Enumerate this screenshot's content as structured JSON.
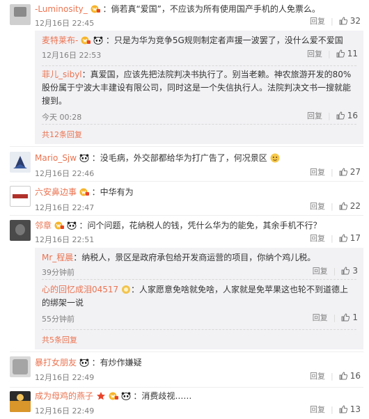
{
  "actions": {
    "reply": "回复"
  },
  "comments": [
    {
      "user": "-Luminosity_",
      "text": "：倘若真“爱国”，不应该为所有使用国产手机的人免票么。",
      "time": "12月16日 22:45",
      "likes": "32",
      "sub": {
        "replies": [
          {
            "user": "麦特莱布-",
            "text": "：只是为华为竞争5G规则制定者声援一波罢了，没什么爱不爱国",
            "time": "12月16日 22:53",
            "likes": "11"
          },
          {
            "user": "菲儿_sibyl",
            "text_lines": [
              "：真爱国，应该先把法院判决书执行了。别当老赖。神农旅游开发的80%",
              "股份属于宁波大丰建设有限公司，同时这是一个失信执行人。法院判决文书一搜就能",
              "搜到。"
            ],
            "time": "今天 00:28",
            "likes": "16"
          }
        ],
        "more": "共12条回复"
      }
    },
    {
      "user": "Mario_Sjw",
      "text": "：没毛病，外交部都给华为打广告了，何况景区",
      "time": "12月16日 22:46",
      "likes": "27"
    },
    {
      "user": "六安鼻边事",
      "text": "：中华有为",
      "time": "12月16日 22:47",
      "likes": "22"
    },
    {
      "user": "邻章",
      "text": "：问个问题，花纳税人的钱，凭什么华为的能免，其余手机不行？",
      "time": "12月16日 22:51",
      "likes": "17",
      "sub": {
        "replies": [
          {
            "user": "Mr_程晨",
            "text": "：纳税人，景区是政府承包给开发商运营的项目，你纳个鸡儿税。",
            "time": "39分钟前",
            "likes": "3"
          },
          {
            "user": "心的回忆成泪04517",
            "text_lines": [
              "：人家愿意免啥就免啥，人家就是免苹果这也轮不到道德上",
              "的绑架一说"
            ],
            "time": "55分钟前",
            "likes": "1"
          }
        ],
        "more": "共5条回复"
      }
    },
    {
      "user": "暴打女朋友",
      "text": "：有炒作嫌疑",
      "time": "12月16日 22:49",
      "likes": "16"
    },
    {
      "user": "成为母鸡的燕子",
      "text": "：消费歧视……",
      "time": "12月16日 22:49",
      "likes": "13"
    }
  ],
  "colors": {
    "username": "#eb7350",
    "meta": "#808080",
    "subbg": "#f2f2f5"
  }
}
